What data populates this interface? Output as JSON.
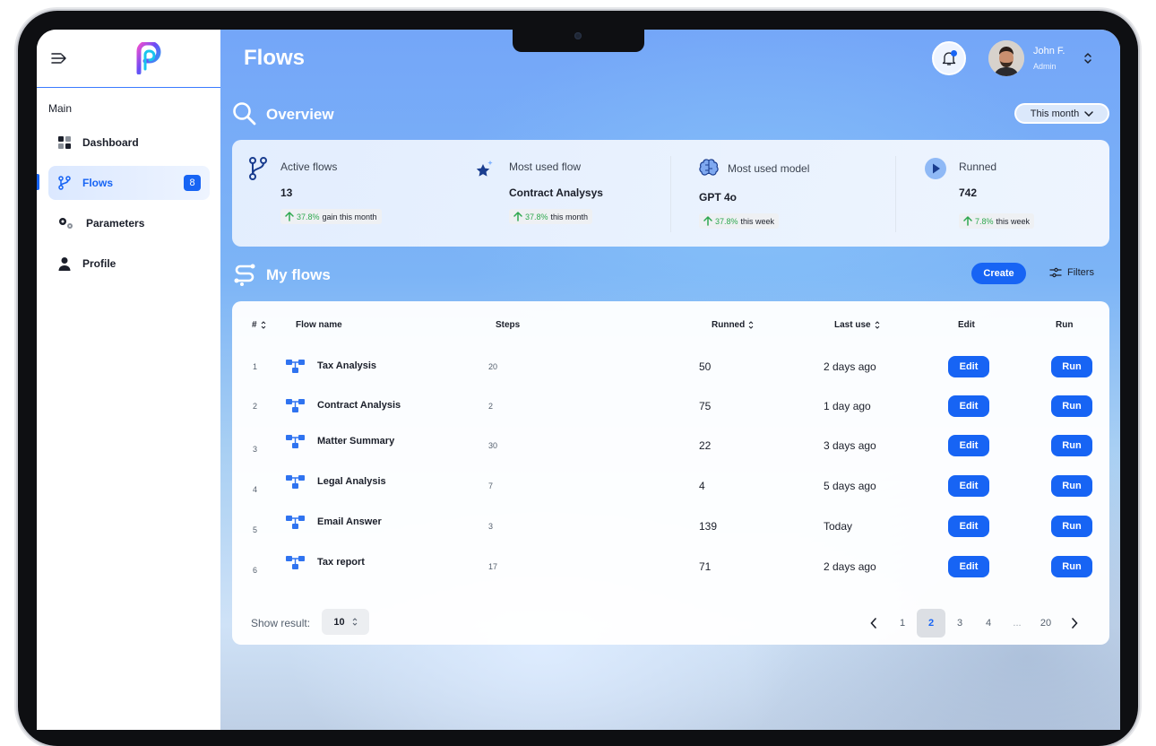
{
  "sidebar": {
    "section_label": "Main",
    "items": [
      {
        "label": "Dashboard"
      },
      {
        "label": "Flows",
        "badge": "8"
      },
      {
        "label": "Parameters"
      },
      {
        "label": "Profile"
      }
    ]
  },
  "header": {
    "title": "Flows",
    "user": {
      "name": "John F.",
      "role": "Admin"
    }
  },
  "overview": {
    "title": "Overview",
    "period": "This month",
    "stats": [
      {
        "label": "Active flows",
        "value": "13",
        "trend_pct": "37.8%",
        "trend_text": "gain this month"
      },
      {
        "label": "Most used flow",
        "value": "Contract Analysys",
        "trend_pct": "37.8%",
        "trend_text": "this month"
      },
      {
        "label": "Most used model",
        "value": "GPT 4o",
        "trend_pct": "37.8%",
        "trend_text": "this week"
      },
      {
        "label": "Runned",
        "value": "742",
        "trend_pct": "7.8%",
        "trend_text": "this week"
      }
    ]
  },
  "flows": {
    "title": "My flows",
    "create_label": "Create",
    "filters_label": "Filters",
    "columns": {
      "index": "#",
      "name": "Flow name",
      "steps": "Steps",
      "runned": "Runned",
      "last_use": "Last use",
      "edit": "Edit",
      "run": "Run"
    },
    "rows": [
      {
        "index": "1",
        "name": "Tax Analysis",
        "steps": "20",
        "runned": "50",
        "last_use": "2 days ago",
        "edit": "Edit",
        "run": "Run"
      },
      {
        "index": "2",
        "name": "Contract Analysis",
        "steps": "2",
        "runned": "75",
        "last_use": "1 day ago",
        "edit": "Edit",
        "run": "Run"
      },
      {
        "index": "3",
        "name": "Matter Summary",
        "steps": "30",
        "runned": "22",
        "last_use": "3 days ago",
        "edit": "Edit",
        "run": "Run"
      },
      {
        "index": "4",
        "name": "Legal Analysis",
        "steps": "7",
        "runned": "4",
        "last_use": "5 days ago",
        "edit": "Edit",
        "run": "Run"
      },
      {
        "index": "5",
        "name": "Email Answer",
        "steps": "3",
        "runned": "139",
        "last_use": "Today",
        "edit": "Edit",
        "run": "Run"
      },
      {
        "index": "6",
        "name": "Tax report",
        "steps": "17",
        "runned": "71",
        "last_use": "2 days ago",
        "edit": "Edit",
        "run": "Run"
      }
    ],
    "show_result_label": "Show result:",
    "show_result_value": "10",
    "pagination": {
      "pages": [
        "1",
        "2",
        "3",
        "4",
        "...",
        "20"
      ],
      "current": "2"
    }
  },
  "colors": {
    "accent": "#1764f4",
    "trend_up": "#2fa84f"
  },
  "icons": [
    "collapse-sidebar-icon",
    "logo-icon",
    "dashboard-icon",
    "flows-icon",
    "parameters-icon",
    "profile-icon",
    "bell-icon",
    "chevron-updown-icon",
    "search-icon",
    "chevron-down-icon",
    "branch-icon",
    "star-sparkle-icon",
    "brain-icon",
    "play-icon",
    "arrow-up-icon",
    "flows-swap-icon",
    "filters-icon",
    "sort-icon",
    "flow-node-icon",
    "chevron-left-icon",
    "chevron-right-icon"
  ]
}
